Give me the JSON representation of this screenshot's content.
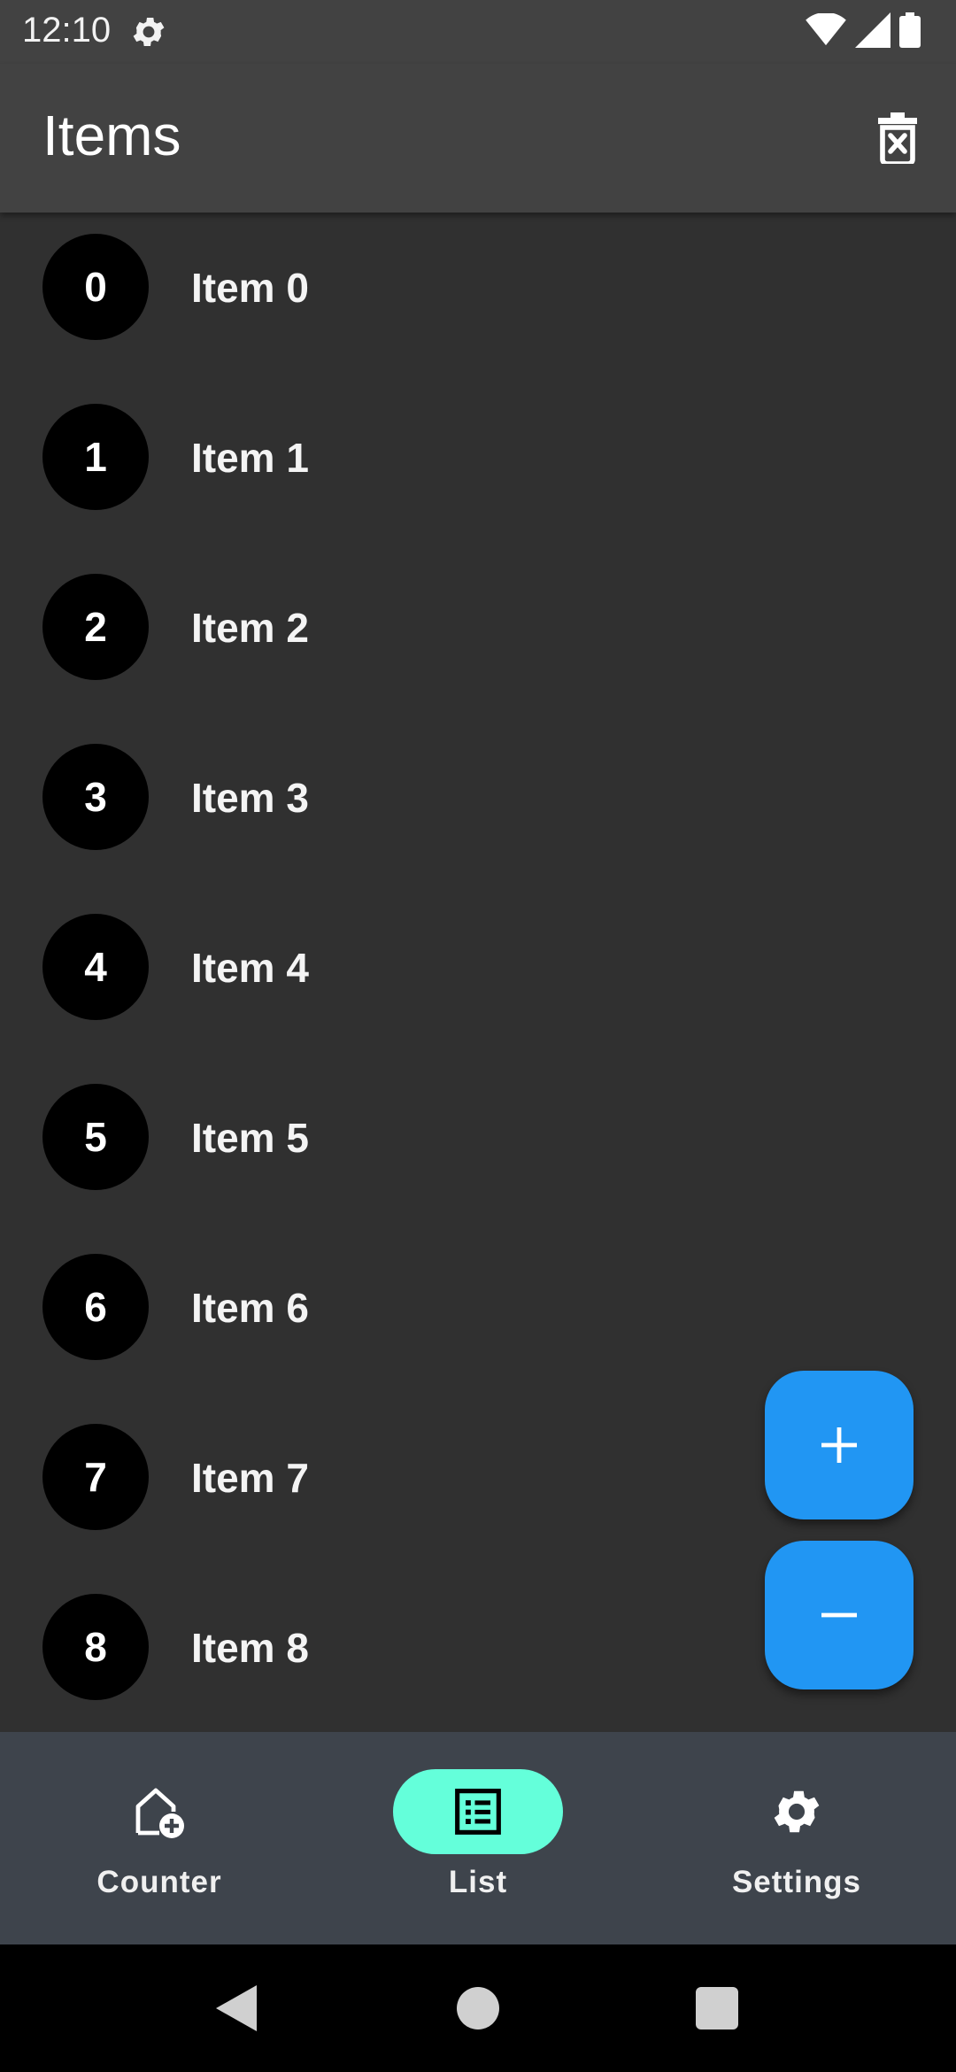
{
  "status_bar": {
    "time": "12:10"
  },
  "app_bar": {
    "title": "Items"
  },
  "items": [
    {
      "index": "0",
      "label": "Item 0"
    },
    {
      "index": "1",
      "label": "Item 1"
    },
    {
      "index": "2",
      "label": "Item 2"
    },
    {
      "index": "3",
      "label": "Item 3"
    },
    {
      "index": "4",
      "label": "Item 4"
    },
    {
      "index": "5",
      "label": "Item 5"
    },
    {
      "index": "6",
      "label": "Item 6"
    },
    {
      "index": "7",
      "label": "Item 7"
    },
    {
      "index": "8",
      "label": "Item 8"
    }
  ],
  "bottom_nav": {
    "counter_label": "Counter",
    "list_label": "List",
    "settings_label": "Settings",
    "selected": "List"
  },
  "colors": {
    "fab": "#2196f3",
    "nav_active_indicator": "#64ffda",
    "app_bar": "#424242",
    "background": "#303030",
    "bottom_nav": "#3e444c"
  }
}
